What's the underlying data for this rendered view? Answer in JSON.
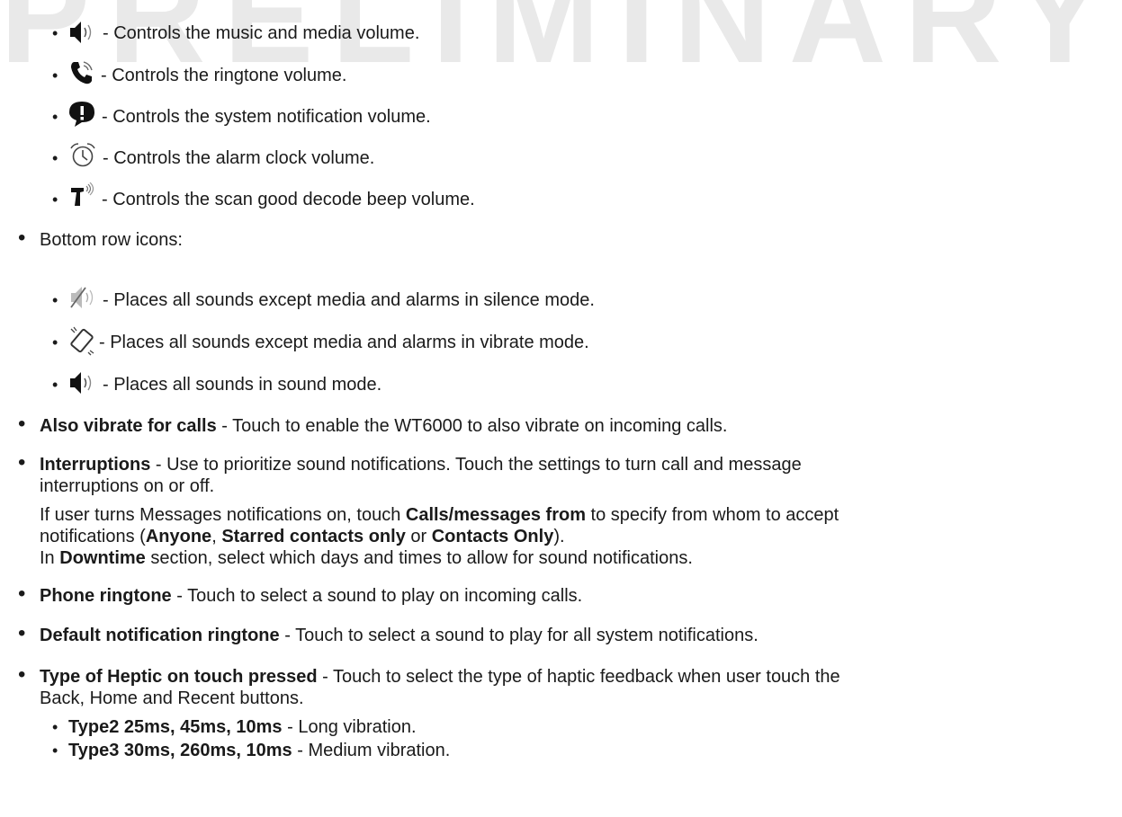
{
  "watermark": "PRELIMINARY",
  "volume_items": [
    {
      "icon": "speaker-icon",
      "text": " - Controls the music and media volume."
    },
    {
      "icon": "phone-icon",
      "text": " - Controls the ringtone volume."
    },
    {
      "icon": "notification-icon",
      "text": " - Controls the system notification volume."
    },
    {
      "icon": "alarm-clock-icon",
      "text": " - Controls the alarm clock volume."
    },
    {
      "icon": "scanner-icon",
      "text": " - Controls the scan good decode beep volume."
    }
  ],
  "bottom_row_label": "Bottom row icons:",
  "bottom_row_items": [
    {
      "icon": "mute-icon",
      "text": " - Places all sounds except media and alarms in silence mode."
    },
    {
      "icon": "vibrate-icon",
      "text": " - Places all sounds except media and alarms in vibrate mode."
    },
    {
      "icon": "speaker-icon",
      "text": " - Places all sounds in sound mode."
    }
  ],
  "vibrate": {
    "term": "Also vibrate for calls",
    "desc": " - Touch to enable the WT6000 to also vibrate on incoming calls."
  },
  "interruptions": {
    "term": "Interruptions",
    "desc_line1": " - Use to prioritize sound notifications. Touch the settings to turn call and message",
    "desc_line2": "interruptions on or off.",
    "p2_a": "If user turns Messages notifications on, touch ",
    "p2_b": "Calls/messages from",
    "p2_c": " to specify from whom to accept",
    "p2_d": "notifications (",
    "p2_e": "Anyone",
    "p2_f": ", ",
    "p2_g": "Starred contacts only",
    "p2_h": " or ",
    "p2_i": "Contacts Only",
    "p2_j": ").",
    "p3_a": "In ",
    "p3_b": "Downtime",
    "p3_c": " section, select which days and times to allow for sound notifications."
  },
  "phone_ringtone": {
    "term": "Phone ringtone",
    "desc": " - Touch to select a sound to play on incoming calls."
  },
  "default_ringtone": {
    "term": "Default notification ringtone",
    "desc": " - Touch to select a sound to play for all system notifications."
  },
  "haptic": {
    "term": "Type of Heptic on touch pressed",
    "desc_line1": " - Touch to select the type of haptic feedback when user touch the",
    "desc_line2": "Back, Home and Recent buttons.",
    "types": [
      {
        "term": "Type2 25ms, 45ms, 10ms",
        "desc": " - Long vibration."
      },
      {
        "term": "Type3 30ms, 260ms, 10ms",
        "desc": " - Medium vibration."
      }
    ]
  }
}
